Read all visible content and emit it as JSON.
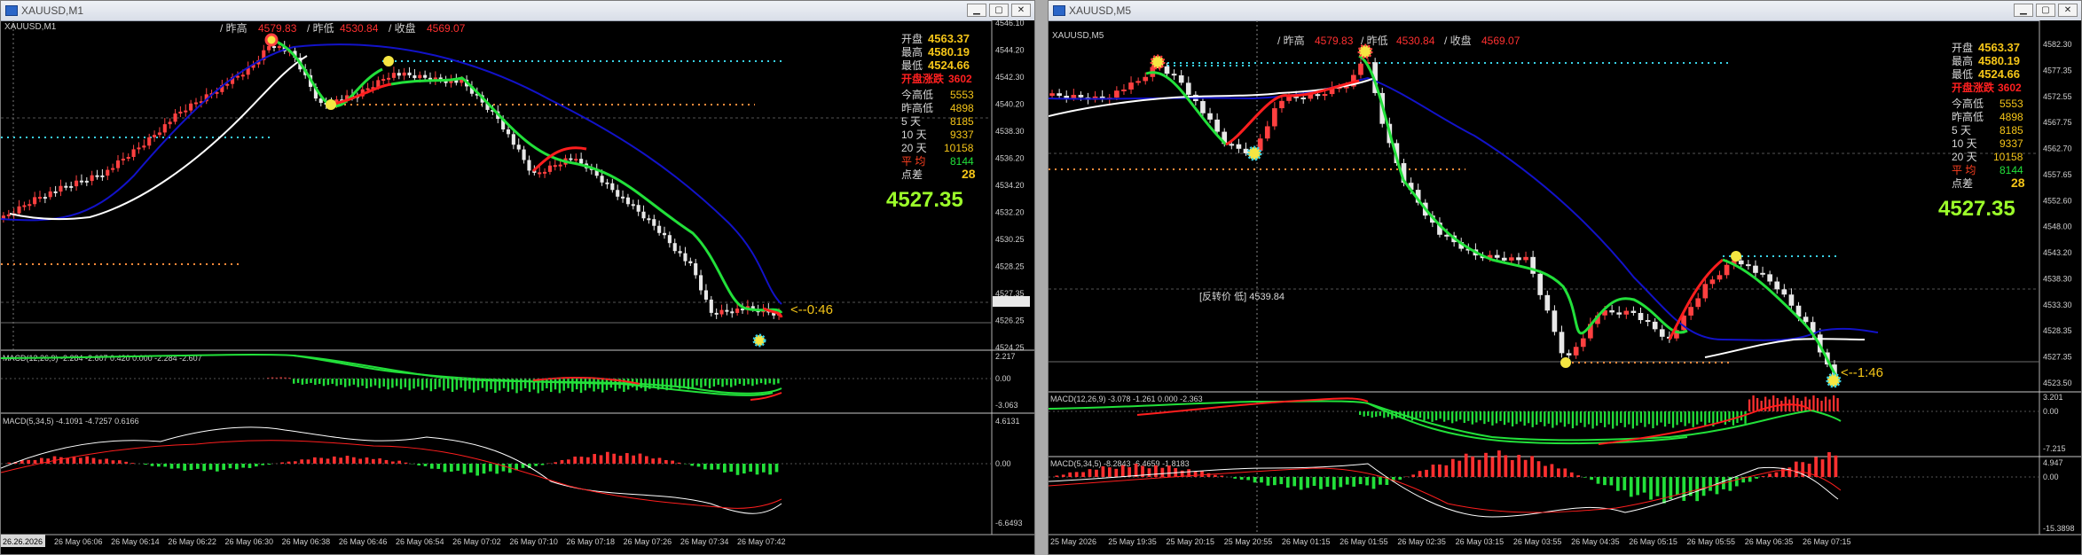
{
  "left": {
    "title": "XAUUSD,M1",
    "chart_label": "XAUUSD,M1",
    "header": {
      "yesterday_high_label": "/ 昨高",
      "yesterday_high_value": "4579.83",
      "yesterday_low_label": "/ 昨低",
      "yesterday_low_value": "4530.84",
      "close_label": "/ 收盘",
      "close_value": "4569.07"
    },
    "stats": [
      {
        "label": "开盘",
        "value": "4563.37"
      },
      {
        "label": "最高",
        "value": "4580.19"
      },
      {
        "label": "最低",
        "value": "4524.66"
      },
      {
        "label": "开盘涨跌",
        "value": "3602"
      },
      {
        "label": "今高低",
        "value": "5553"
      },
      {
        "label": "昨高低",
        "value": "4898"
      },
      {
        "label": "5  天",
        "value": "8185"
      },
      {
        "label": "10 天",
        "value": "9337"
      },
      {
        "label": "20 天",
        "value": "10158"
      },
      {
        "label": "平  均",
        "value": "8144"
      },
      {
        "label": "点差",
        "value": "28"
      }
    ],
    "big_price": "4527.35",
    "countdown": "<--0:46",
    "price_axis": [
      "4546.10",
      "4544.20",
      "4542.30",
      "4540.20",
      "4538.30",
      "4536.20",
      "4534.20",
      "4532.20",
      "4530.25",
      "4528.25",
      "4527.35",
      "4526.25",
      "4524.25"
    ],
    "macd1_label": "MACD(12,26,9) -2.284 -2.607 0.420 0.000 -2.284 -2.607",
    "macd1_axis": [
      "2.217",
      "0.00",
      "-3.063"
    ],
    "macd2_label": "MACD(5,34,5) -4.1091 -4.7257 0.6166",
    "macd2_axis": [
      "4.6131",
      "0.00",
      "-6.6493"
    ],
    "time_start": "26.26.2026",
    "time_axis": [
      "26 May 06:06",
      "26 May 06:14",
      "26 May 06:22",
      "26 May 06:30",
      "26 May 06:38",
      "26 May 06:46",
      "26 May 06:54",
      "26 May 07:02",
      "26 May 07:10",
      "26 May 07:18",
      "26 May 07:26",
      "26 May 07:34",
      "26 May 07:42"
    ]
  },
  "right": {
    "title": "XAUUSD,M5",
    "chart_label": "XAUUSD,M5",
    "header": {
      "yesterday_high_label": "/ 昨高",
      "yesterday_high_value": "4579.83",
      "yesterday_low_label": "/ 昨低",
      "yesterday_low_value": "4530.84",
      "close_label": "/ 收盘",
      "close_value": "4569.07"
    },
    "stats": [
      {
        "label": "开盘",
        "value": "4563.37"
      },
      {
        "label": "最高",
        "value": "4580.19"
      },
      {
        "label": "最低",
        "value": "4524.66"
      },
      {
        "label": "开盘涨跌",
        "value": "3602"
      },
      {
        "label": "今高低",
        "value": "5553"
      },
      {
        "label": "昨高低",
        "value": "4898"
      },
      {
        "label": "5  天",
        "value": "8185"
      },
      {
        "label": "10 天",
        "value": "9337"
      },
      {
        "label": "20 天",
        "value": "10158"
      },
      {
        "label": "平  均",
        "value": "8144"
      },
      {
        "label": "点差",
        "value": "28"
      }
    ],
    "big_price": "4527.35",
    "countdown": "<--1:46",
    "reversal_label": "[反转价 低] 4539.84",
    "price_axis": [
      "4582.30",
      "4577.35",
      "4572.55",
      "4567.75",
      "4562.70",
      "4557.65",
      "4552.60",
      "4548.00",
      "4543.20",
      "4538.30",
      "4533.30",
      "4528.35",
      "4527.35",
      "4523.50"
    ],
    "macd1_label": "MACD(12,26,9) -3.078 -1.261 0.000 -2.363",
    "macd1_axis": [
      "3.201",
      "0.00",
      "-7.215"
    ],
    "macd2_label": "MACD(5,34,5) -8.2843 -6.4659 -1.8183",
    "macd2_axis": [
      "4.947",
      "0.00",
      "-15.3898"
    ],
    "time_axis": [
      "25 May 2026",
      "25 May 19:35",
      "25 May 20:15",
      "25 May 20:55",
      "26 May 01:15",
      "26 May 01:55",
      "26 May 02:35",
      "26 May 03:15",
      "26 May 03:55",
      "26 May 04:35",
      "26 May 05:15",
      "26 May 05:55",
      "26 May 06:35",
      "26 May 07:15"
    ]
  },
  "colors": {
    "up": "#ff4040",
    "down": "#e8e8e8",
    "trend_green": "#22e03a",
    "trend_red": "#ff1e1e",
    "ma_blue": "#1212c8",
    "ma_white": "#ffffff",
    "stat_value": "#f5c518",
    "big_price": "#9cff2a",
    "dot_cyan": "#39d1e6",
    "dot_orange": "#ff8a3a"
  }
}
